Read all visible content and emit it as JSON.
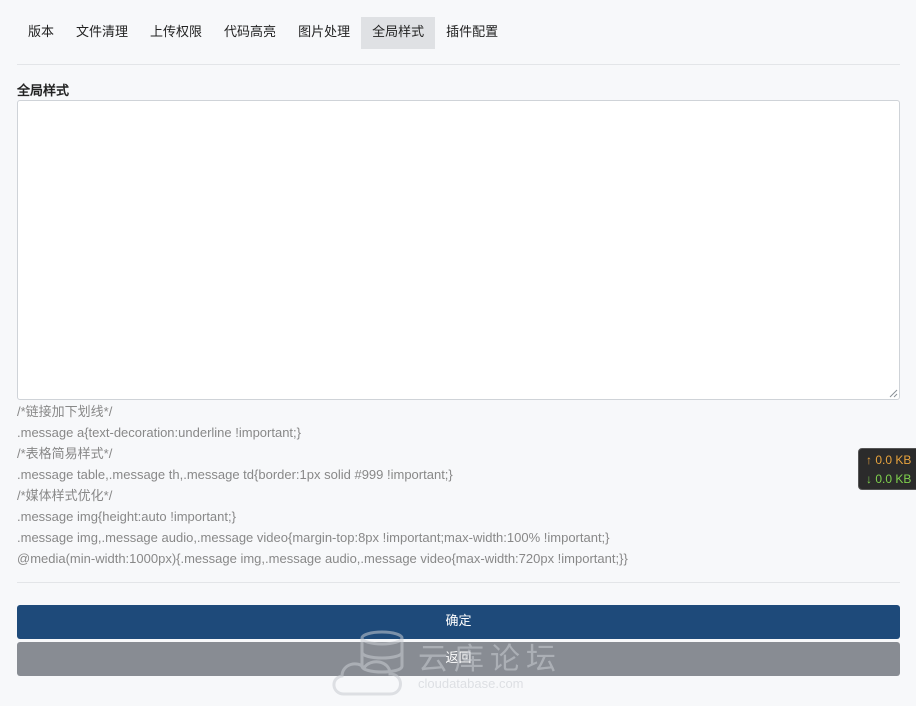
{
  "tabs": [
    {
      "label": "版本",
      "active": false
    },
    {
      "label": "文件清理",
      "active": false
    },
    {
      "label": "上传权限",
      "active": false
    },
    {
      "label": "代码高亮",
      "active": false
    },
    {
      "label": "图片处理",
      "active": false
    },
    {
      "label": "全局样式",
      "active": true
    },
    {
      "label": "插件配置",
      "active": false
    }
  ],
  "form": {
    "field_label": "全局样式",
    "textarea_value": "",
    "help_lines": [
      "/*链接加下划线*/",
      ".message a{text-decoration:underline !important;}",
      "/*表格简易样式*/",
      ".message table,.message th,.message td{border:1px solid #999 !important;}",
      "/*媒体样式优化*/",
      ".message img{height:auto !important;}",
      ".message img,.message audio,.message video{margin-top:8px !important;max-width:100% !important;}",
      "@media(min-width:1000px){.message img,.message audio,.message video{max-width:720px !important;}}"
    ]
  },
  "actions": {
    "confirm_label": "确定",
    "back_label": "返回"
  },
  "speed_widget": {
    "upload": "↑ 0.0 KB",
    "download": "↓ 0.0 KB"
  },
  "watermark": {
    "title": "云库论坛",
    "subtitle": "cloudatabase.com"
  },
  "colors": {
    "primary": "#1e4a7a",
    "secondary": "#888c93",
    "active_tab": "#dfe1e4",
    "background": "#f7f8fa"
  }
}
